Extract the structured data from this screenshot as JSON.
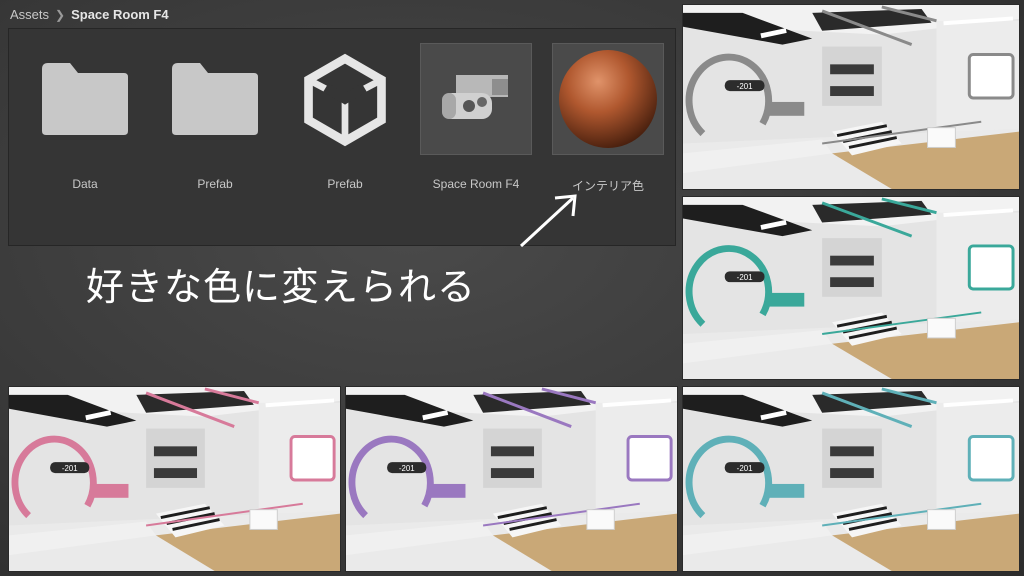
{
  "breadcrumb": {
    "root": "Assets",
    "current": "Space Room F4"
  },
  "assets": [
    {
      "label": "Data",
      "icon": "folder-icon"
    },
    {
      "label": "Prefab",
      "icon": "folder-icon"
    },
    {
      "label": "Prefab",
      "icon": "unity-prefab-icon"
    },
    {
      "label": "Space Room F4",
      "icon": "space-room-model-thumbnail"
    },
    {
      "label": "インテリア色",
      "icon": "material-sphere-thumbnail"
    }
  ],
  "caption": "好きな色に変えられる",
  "room_label": "201",
  "previews": [
    {
      "accent": "#8a8a8a"
    },
    {
      "accent": "#3aa89a"
    },
    {
      "accent": "#d77a9a"
    },
    {
      "accent": "#9a78c0"
    },
    {
      "accent": "#5fb0b8"
    }
  ]
}
